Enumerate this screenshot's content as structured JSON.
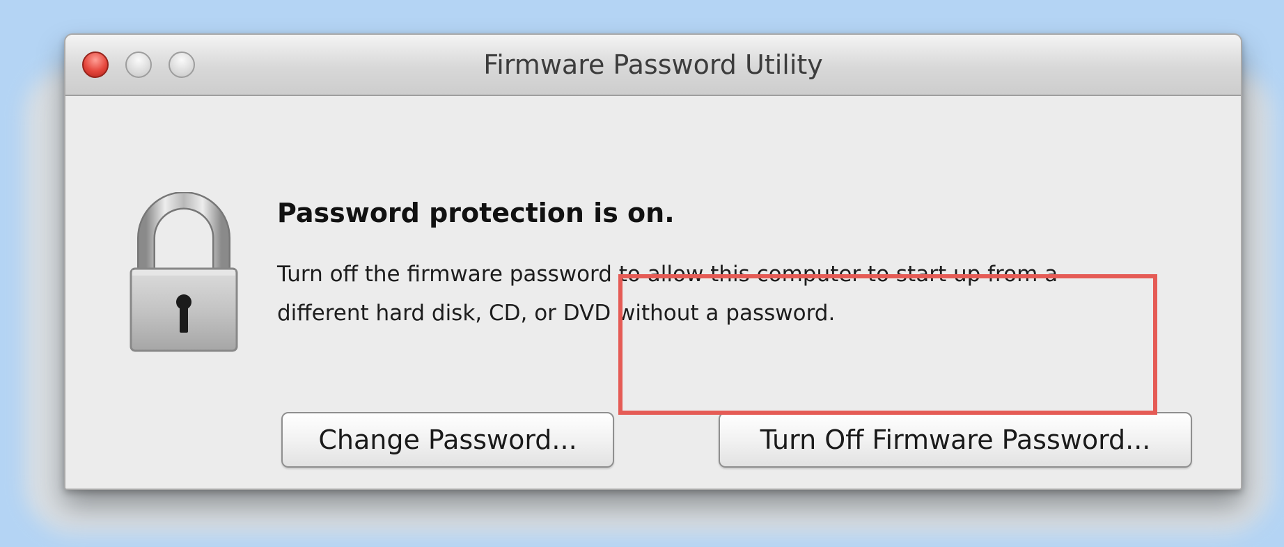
{
  "window": {
    "title": "Firmware Password Utility",
    "controls": [
      "close",
      "minimize",
      "zoom"
    ]
  },
  "content": {
    "icon": "lock-icon",
    "heading": "Password protection is on.",
    "description": "Turn off the firmware password to allow this computer to start up from a different hard disk, CD, or DVD without a password."
  },
  "buttons": {
    "change_password": "Change Password...",
    "turn_off": "Turn Off Firmware Password..."
  },
  "colors": {
    "background": "#b4d4f4",
    "window": "#ececec",
    "close_button": "#e5473d",
    "highlight": "#e55b55"
  }
}
